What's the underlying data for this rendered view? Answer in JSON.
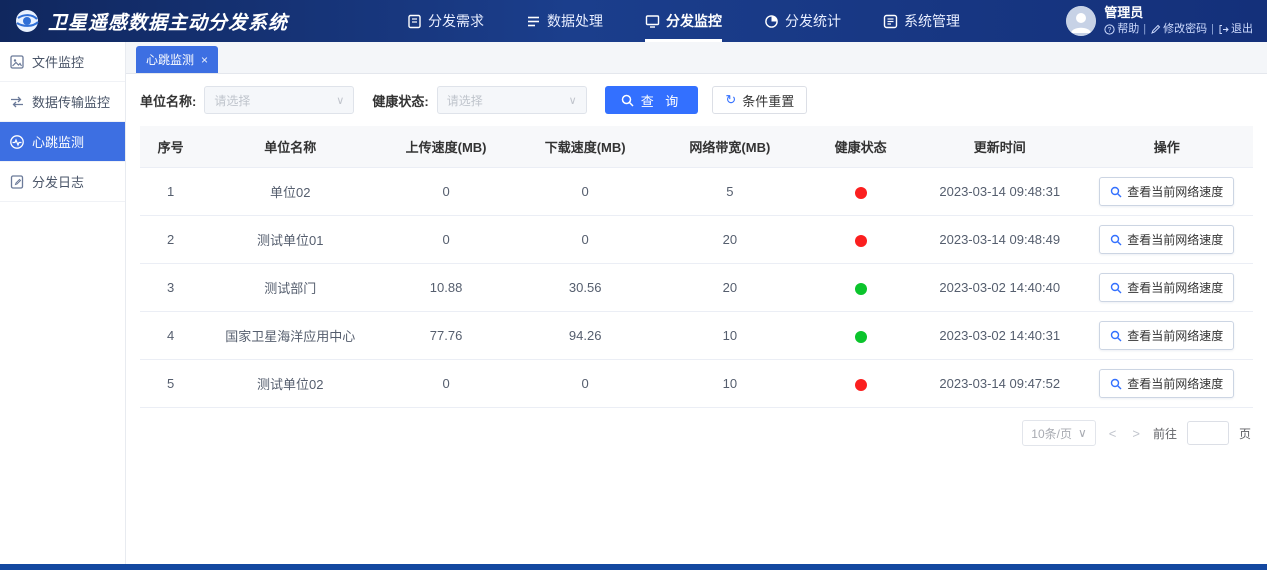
{
  "header": {
    "title": "卫星遥感数据主动分发系统",
    "nav": [
      {
        "label": "分发需求"
      },
      {
        "label": "数据处理"
      },
      {
        "label": "分发监控"
      },
      {
        "label": "分发统计"
      },
      {
        "label": "系统管理"
      }
    ],
    "user": {
      "role": "管理员",
      "links": {
        "help": "帮助",
        "change_password": "修改密码",
        "logout": "退出"
      },
      "separator": "|"
    }
  },
  "sidebar": {
    "items": [
      {
        "label": "文件监控"
      },
      {
        "label": "数据传输监控"
      },
      {
        "label": "心跳监测"
      },
      {
        "label": "分发日志"
      }
    ]
  },
  "tabs": [
    {
      "label": "心跳监测",
      "close_glyph": "×"
    }
  ],
  "filters": {
    "unit_label": "单位名称:",
    "unit_placeholder": "请选择",
    "health_label": "健康状态:",
    "health_placeholder": "请选择",
    "query_button": "查 询",
    "reset_button": "条件重置"
  },
  "icons": {
    "chevron_down": "∨",
    "refresh": "↻",
    "prev": "<",
    "next": ">"
  },
  "table": {
    "columns": [
      "序号",
      "单位名称",
      "上传速度(MB)",
      "下载速度(MB)",
      "网络带宽(MB)",
      "健康状态",
      "更新时间",
      "操作"
    ],
    "action_label": "查看当前网络速度",
    "rows": [
      {
        "index": "1",
        "unit": "单位02",
        "upload": "0",
        "download": "0",
        "bandwidth": "5",
        "health": "red",
        "updated": "2023-03-14 09:48:31"
      },
      {
        "index": "2",
        "unit": "测试单位01",
        "upload": "0",
        "download": "0",
        "bandwidth": "20",
        "health": "red",
        "updated": "2023-03-14 09:48:49"
      },
      {
        "index": "3",
        "unit": "测试部门",
        "upload": "10.88",
        "download": "30.56",
        "bandwidth": "20",
        "health": "green",
        "updated": "2023-03-02 14:40:40"
      },
      {
        "index": "4",
        "unit": "国家卫星海洋应用中心",
        "upload": "77.76",
        "download": "94.26",
        "bandwidth": "10",
        "health": "green",
        "updated": "2023-03-02 14:40:31"
      },
      {
        "index": "5",
        "unit": "测试单位02",
        "upload": "0",
        "download": "0",
        "bandwidth": "10",
        "health": "red",
        "updated": "2023-03-14 09:47:52"
      }
    ]
  },
  "pagination": {
    "page_size": "10条/页",
    "goto_label": "前往",
    "page_label": "页"
  },
  "colors": {
    "accent_blue": "#3370ff",
    "header_blue": "#1b3e8c",
    "sidebar_active": "#3d6fe2",
    "health_red": "#fb1f1f",
    "health_green": "#0bc42c"
  }
}
